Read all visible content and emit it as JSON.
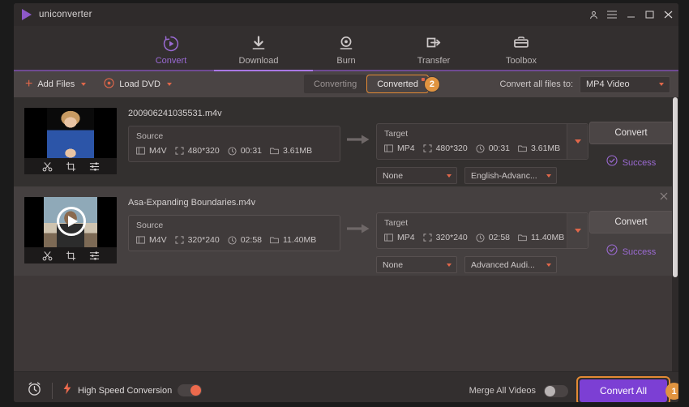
{
  "window": {
    "app_title": "uniconverter",
    "controls": [
      {
        "name": "account-icon",
        "glyph": "\u0000"
      },
      {
        "name": "menu-icon",
        "glyph": "\u0000"
      },
      {
        "name": "minimize-icon",
        "glyph": "\u0000"
      },
      {
        "name": "maximize-icon",
        "glyph": "\u0000"
      },
      {
        "name": "close-icon",
        "glyph": "\u0000"
      }
    ]
  },
  "nav": {
    "tabs": [
      {
        "label": "Convert",
        "icon": "convert-icon",
        "active": true
      },
      {
        "label": "Download",
        "icon": "download-icon",
        "active": false
      },
      {
        "label": "Burn",
        "icon": "burn-icon",
        "active": false
      },
      {
        "label": "Transfer",
        "icon": "transfer-icon",
        "active": false
      },
      {
        "label": "Toolbox",
        "icon": "toolbox-icon",
        "active": false
      }
    ],
    "accent_color": "#a977e4"
  },
  "toolbar": {
    "add_files_label": "Add Files",
    "load_dvd_label": "Load DVD",
    "segments": [
      {
        "label": "Converting",
        "active": false
      },
      {
        "label": "Converted",
        "active": true
      }
    ],
    "converted_badge": "2",
    "convert_all_files_to_label": "Convert all files to:",
    "output_format": "MP4 Video",
    "accent_color": "#e0674a",
    "highlight_color": "#e38a34"
  },
  "files": [
    {
      "name": "200906241035531.m4v",
      "source": {
        "title": "Source",
        "format": "M4V",
        "resolution": "480*320",
        "duration": "00:31",
        "size": "3.61MB"
      },
      "target": {
        "title": "Target",
        "format": "MP4",
        "resolution": "480*320",
        "duration": "00:31",
        "size": "3.61MB"
      },
      "subtitle_select": "None",
      "audio_select": "English-Advanc...",
      "convert_label": "Convert",
      "status": "Success",
      "status_color": "#9b6ad2",
      "playing": false,
      "edit_icons": [
        "trim-icon",
        "crop-icon",
        "effect-icon"
      ]
    },
    {
      "name": "Asa-Expanding Boundaries.m4v",
      "source": {
        "title": "Source",
        "format": "M4V",
        "resolution": "320*240",
        "duration": "02:58",
        "size": "11.40MB"
      },
      "target": {
        "title": "Target",
        "format": "MP4",
        "resolution": "320*240",
        "duration": "02:58",
        "size": "11.40MB"
      },
      "subtitle_select": "None",
      "audio_select": "Advanced Audi...",
      "convert_label": "Convert",
      "status": "Success",
      "status_color": "#9b6ad2",
      "playing": true,
      "edit_icons": [
        "trim-icon",
        "crop-icon",
        "effect-icon"
      ]
    }
  ],
  "bottom": {
    "high_speed_label": "High Speed Conversion",
    "high_speed_on": true,
    "merge_label": "Merge All Videos",
    "merge_on": false,
    "convert_all_label": "Convert All",
    "convert_all_badge": "1",
    "convert_all_color": "#7c3fd4"
  }
}
